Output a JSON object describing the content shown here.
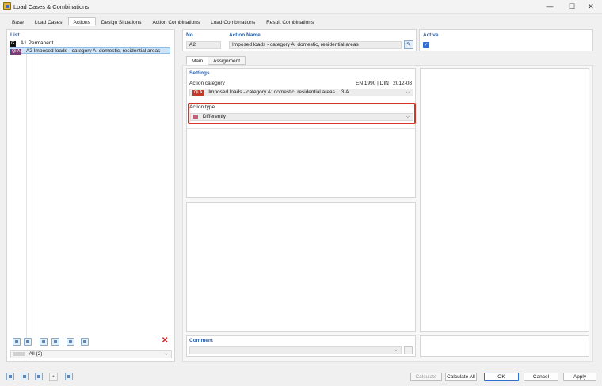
{
  "window": {
    "title": "Load Cases & Combinations",
    "minimize_glyph": "—",
    "maximize_glyph": "☐",
    "close_glyph": "✕"
  },
  "tabs": [
    "Base",
    "Load Cases",
    "Actions",
    "Design Situations",
    "Action Combinations",
    "Load Combinations",
    "Result Combinations"
  ],
  "active_tab": "Actions",
  "list": {
    "label": "List",
    "items": [
      {
        "badge": "G",
        "badge_color": "#111111",
        "id": "A1",
        "name": "Permanent"
      },
      {
        "badge": "Qi A",
        "badge_color": "#7a3a73",
        "id": "A2",
        "name": "Imposed loads - category A: domestic, residential areas"
      }
    ],
    "filter": "All (2)"
  },
  "header": {
    "no_label": "No.",
    "no_value": "A2",
    "action_name_label": "Action Name",
    "action_name_value": "Imposed loads - category A: domestic, residential areas",
    "active_label": "Active",
    "active_checked": true
  },
  "subtabs": [
    "Main",
    "Assignment"
  ],
  "settings": {
    "title": "Settings",
    "action_category_label": "Action category",
    "standard": "EN 1990 | DIN | 2012-08",
    "category_badge": "Qi A",
    "category_badge_color": "#c0392b",
    "category_text": "Imposed loads - category A: domestic, residential areas",
    "category_code": "3.A",
    "action_type_label": "Action type",
    "action_type_value": "Differently",
    "action_type_color": "#c2607a",
    "highlight_color": "#d9322b"
  },
  "comment": {
    "label": "Comment",
    "value": ""
  },
  "buttons": {
    "calculate": "Calculate",
    "calculate_all": "Calculate All",
    "ok": "OK",
    "cancel": "Cancel",
    "apply": "Apply"
  },
  "icons": [
    "search-icon",
    "units-icon",
    "display-icon",
    "info-icon",
    "script-icon"
  ]
}
